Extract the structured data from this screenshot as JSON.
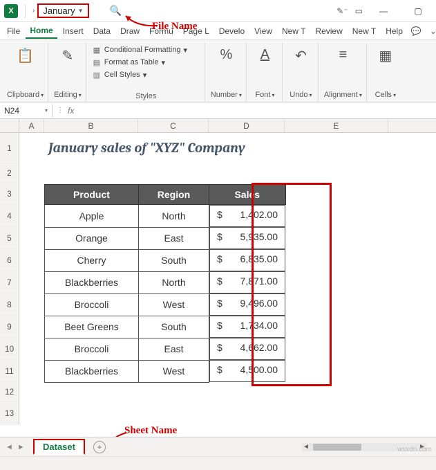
{
  "titlebar": {
    "file_name": "January",
    "annotation_file": "File Name"
  },
  "menu": {
    "items": [
      "File",
      "Home",
      "Insert",
      "Data",
      "Draw",
      "Formu",
      "Page L",
      "Develo",
      "View",
      "New T",
      "Review",
      "New T",
      "Help"
    ],
    "active": "Home"
  },
  "ribbon": {
    "clipboard": "Clipboard",
    "editing": "Editing",
    "styles_title": "Styles",
    "cond_format": "Conditional Formatting",
    "format_table": "Format as Table",
    "cell_styles": "Cell Styles",
    "number": "Number",
    "font": "Font",
    "undo": "Undo",
    "alignment": "Alignment",
    "cells": "Cells"
  },
  "namebox": {
    "ref": "N24",
    "fx": "fx"
  },
  "columns": [
    "A",
    "B",
    "C",
    "D",
    "E"
  ],
  "rows": [
    "1",
    "2",
    "3",
    "4",
    "5",
    "6",
    "7",
    "8",
    "9",
    "10",
    "11",
    "12",
    "13"
  ],
  "sheet_title": "January sales of \"XYZ\" Company",
  "table": {
    "headers": {
      "product": "Product",
      "region": "Region",
      "sales": "Sales"
    },
    "rows": [
      {
        "product": "Apple",
        "region": "North",
        "cur": "$",
        "sales": "1,402.00"
      },
      {
        "product": "Orange",
        "region": "East",
        "cur": "$",
        "sales": "5,935.00"
      },
      {
        "product": "Cherry",
        "region": "South",
        "cur": "$",
        "sales": "6,835.00"
      },
      {
        "product": "Blackberries",
        "region": "North",
        "cur": "$",
        "sales": "7,871.00"
      },
      {
        "product": "Broccoli",
        "region": "West",
        "cur": "$",
        "sales": "9,496.00"
      },
      {
        "product": "Beet Greens",
        "region": "South",
        "cur": "$",
        "sales": "1,734.00"
      },
      {
        "product": "Broccoli",
        "region": "East",
        "cur": "$",
        "sales": "4,662.00"
      },
      {
        "product": "Blackberries",
        "region": "West",
        "cur": "$",
        "sales": "4,500.00"
      }
    ]
  },
  "sheet_tab": "Dataset",
  "annotation_sheet": "Sheet Name",
  "watermark": "wsxdn.com"
}
